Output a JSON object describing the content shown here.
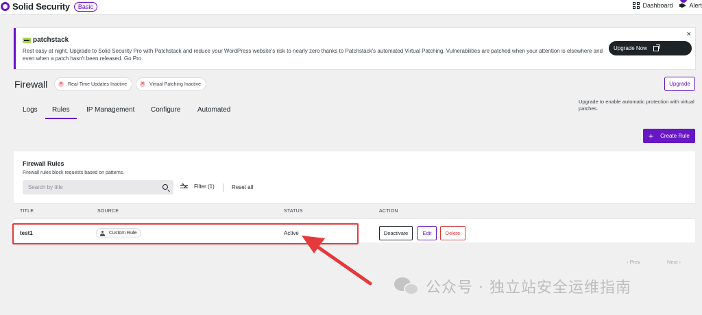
{
  "header": {
    "brand": "Solid Security",
    "plan_badge": "Basic",
    "dashboard_label": "Dashboard",
    "alerts_label": "Alert"
  },
  "promo": {
    "logo_text": "patchstack",
    "text": "Rest easy at night. Upgrade to Solid Security Pro with Patchstack and reduce your WordPress website's risk to nearly zero thanks to Patchstack's automated Virtual Patching. Vulnerabilities are patched when your attention is elsewhere and even when a patch hasn't been released. Go Pro.",
    "button_label": "Upgrade Now",
    "close": "×"
  },
  "firewall": {
    "title": "Firewall",
    "pill_realtime": "Real-Time Updates Inactive",
    "pill_patching": "Virtual Patching Inactive",
    "upgrade_label": "Upgrade",
    "upgrade_note": "Upgrade to enable automatic protection with virtual patches."
  },
  "tabs": [
    {
      "label": "Logs"
    },
    {
      "label": "Rules"
    },
    {
      "label": "IP Management"
    },
    {
      "label": "Configure"
    },
    {
      "label": "Automated"
    }
  ],
  "active_tab": "Rules",
  "create_rule_label": "Create Rule",
  "rules_card": {
    "title": "Firewall Rules",
    "subtitle": "Firewall rules block requests based on patterns.",
    "search_placeholder": "Search by title",
    "filter_label": "Filter (1)",
    "reset_label": "Reset all",
    "columns": [
      "TITLE",
      "SOURCE",
      "STATUS",
      "ACTION"
    ],
    "rows": [
      {
        "title": "test1",
        "source": "Custom Rule",
        "status": "Active",
        "actions": [
          "Deactivate",
          "Edit",
          "Delete"
        ]
      }
    ]
  },
  "pagination": {
    "prev": "‹  Prev",
    "next": "Next  ›"
  },
  "watermark": "公众号 · 独立站安全运维指南",
  "colors": {
    "accent": "#6817c5",
    "danger": "#d63638",
    "annotation": "#e5393a"
  }
}
